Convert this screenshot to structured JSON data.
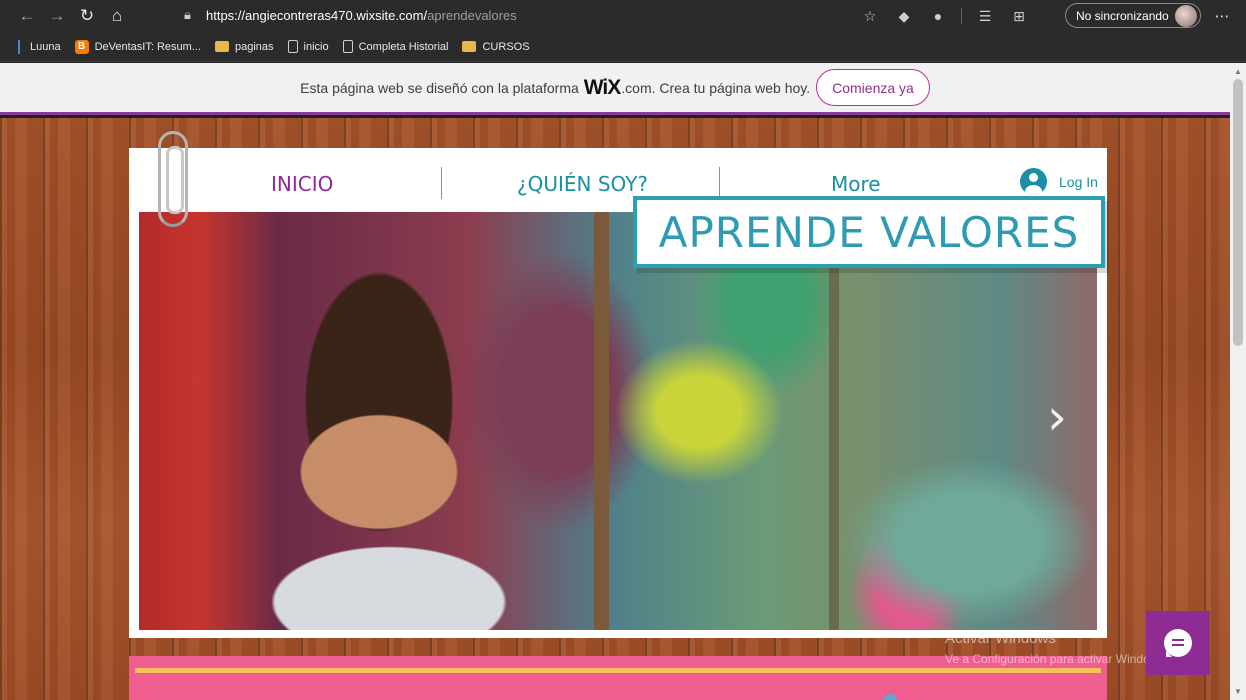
{
  "browser": {
    "url_host": "https://angiecontreras470.wixsite.com/",
    "url_path": "aprendevalores",
    "profile_label": "No sincronizando"
  },
  "bookmarks": [
    {
      "label": "Luuna"
    },
    {
      "label": "DeVentasIT: Resum..."
    },
    {
      "label": "paginas"
    },
    {
      "label": "inicio"
    },
    {
      "label": "Completa Historial"
    },
    {
      "label": "CURSOS"
    }
  ],
  "wix_banner": {
    "text_before": "Esta página web se diseñó con la plataforma",
    "logo": "WiX",
    "text_after": ".com. Crea tu página web hoy.",
    "cta": "Comienza ya"
  },
  "site": {
    "nav": {
      "inicio": "INICIO",
      "quien": "¿QUIÉN SOY?",
      "more": "More",
      "login": "Log In"
    },
    "hero_title": "APRENDE VALORES"
  },
  "watermark": {
    "line1": "Activar Windows",
    "line2": "Ve a Configuración para activar Windows."
  },
  "colors": {
    "purple": "#8e2c93",
    "teal": "#2e9bb2",
    "pink": "#ef5e8f"
  }
}
